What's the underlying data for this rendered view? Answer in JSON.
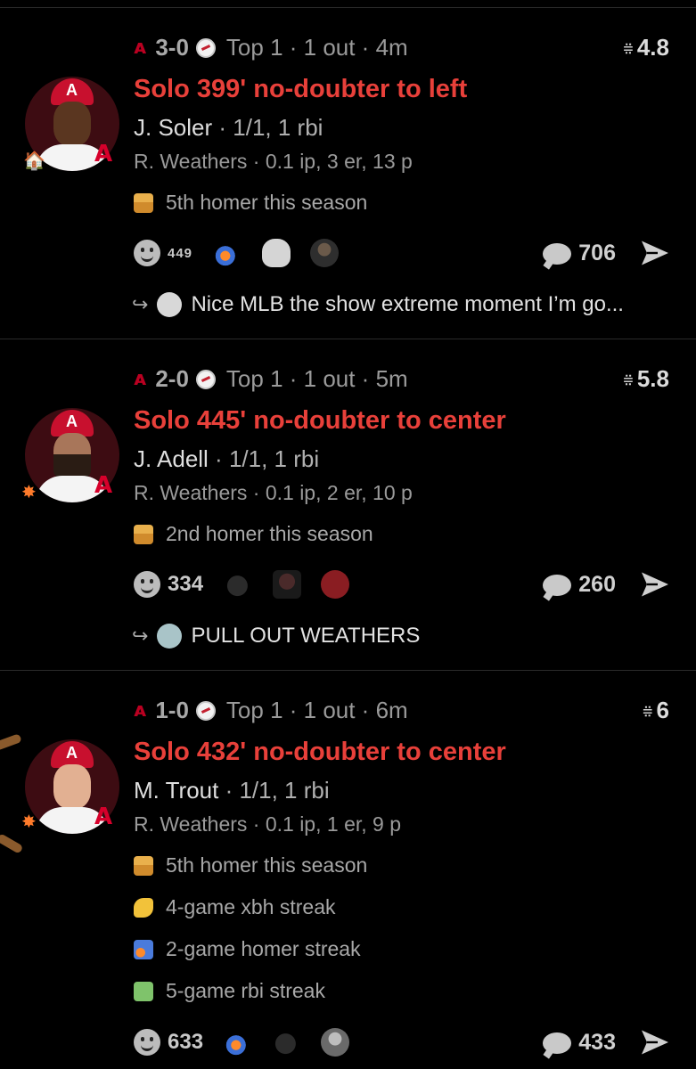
{
  "feed": [
    {
      "score": "3-0",
      "inning": "Top 1 · 1 out · 4m",
      "exit_value": "4.8",
      "title": "Solo 399' no-doubter to left",
      "batter_name": "J. Soler",
      "batter_stat": "1/1, 1 rbi",
      "pitcher_line": "R. Weathers · 0.1 ip, 3 er, 13 p",
      "notes": [
        {
          "icon": "house-icon",
          "text": "5th homer this season"
        }
      ],
      "reaction_count": "449",
      "reactions": [
        "rocket-emoji",
        "skull-emoji",
        "person-emoji"
      ],
      "comment_count": "706",
      "reply_text": "Nice MLB the show extreme moment I’m go..."
    },
    {
      "score": "2-0",
      "inning": "Top 1 · 1 out · 5m",
      "exit_value": "5.8",
      "title": "Solo 445' no-doubter to center",
      "batter_name": "J. Adell",
      "batter_stat": "1/1, 1 rbi",
      "pitcher_line": "R. Weathers · 0.1 ip, 2 er, 10 p",
      "notes": [
        {
          "icon": "house-icon",
          "text": "2nd homer this season"
        }
      ],
      "reaction_count": "334",
      "reactions": [
        "bomb-emoji",
        "person-emoji",
        "red-circle-emoji"
      ],
      "comment_count": "260",
      "reply_text": "PULL OUT WEATHERS"
    },
    {
      "score": "1-0",
      "inning": "Top 1 · 1 out · 6m",
      "exit_value": "6",
      "title": "Solo 432' no-doubter to center",
      "batter_name": "M. Trout",
      "batter_stat": "1/1, 1 rbi",
      "pitcher_line": "R. Weathers · 0.1 ip, 1 er, 9 p",
      "notes": [
        {
          "icon": "house-icon",
          "text": "5th homer this season"
        },
        {
          "icon": "flexed-biceps-icon",
          "text": "4-game xbh streak"
        },
        {
          "icon": "rocket-icon",
          "text": "2-game homer streak"
        },
        {
          "icon": "money-icon",
          "text": "5-game rbi streak"
        }
      ],
      "reaction_count": "633",
      "reactions": [
        "rocket-emoji",
        "bomb-emoji",
        "person-emoji"
      ],
      "comment_count": "433"
    }
  ],
  "colors": {
    "background": "#000000",
    "title_red": "#e8403a",
    "angels_red": "#ba0021"
  }
}
